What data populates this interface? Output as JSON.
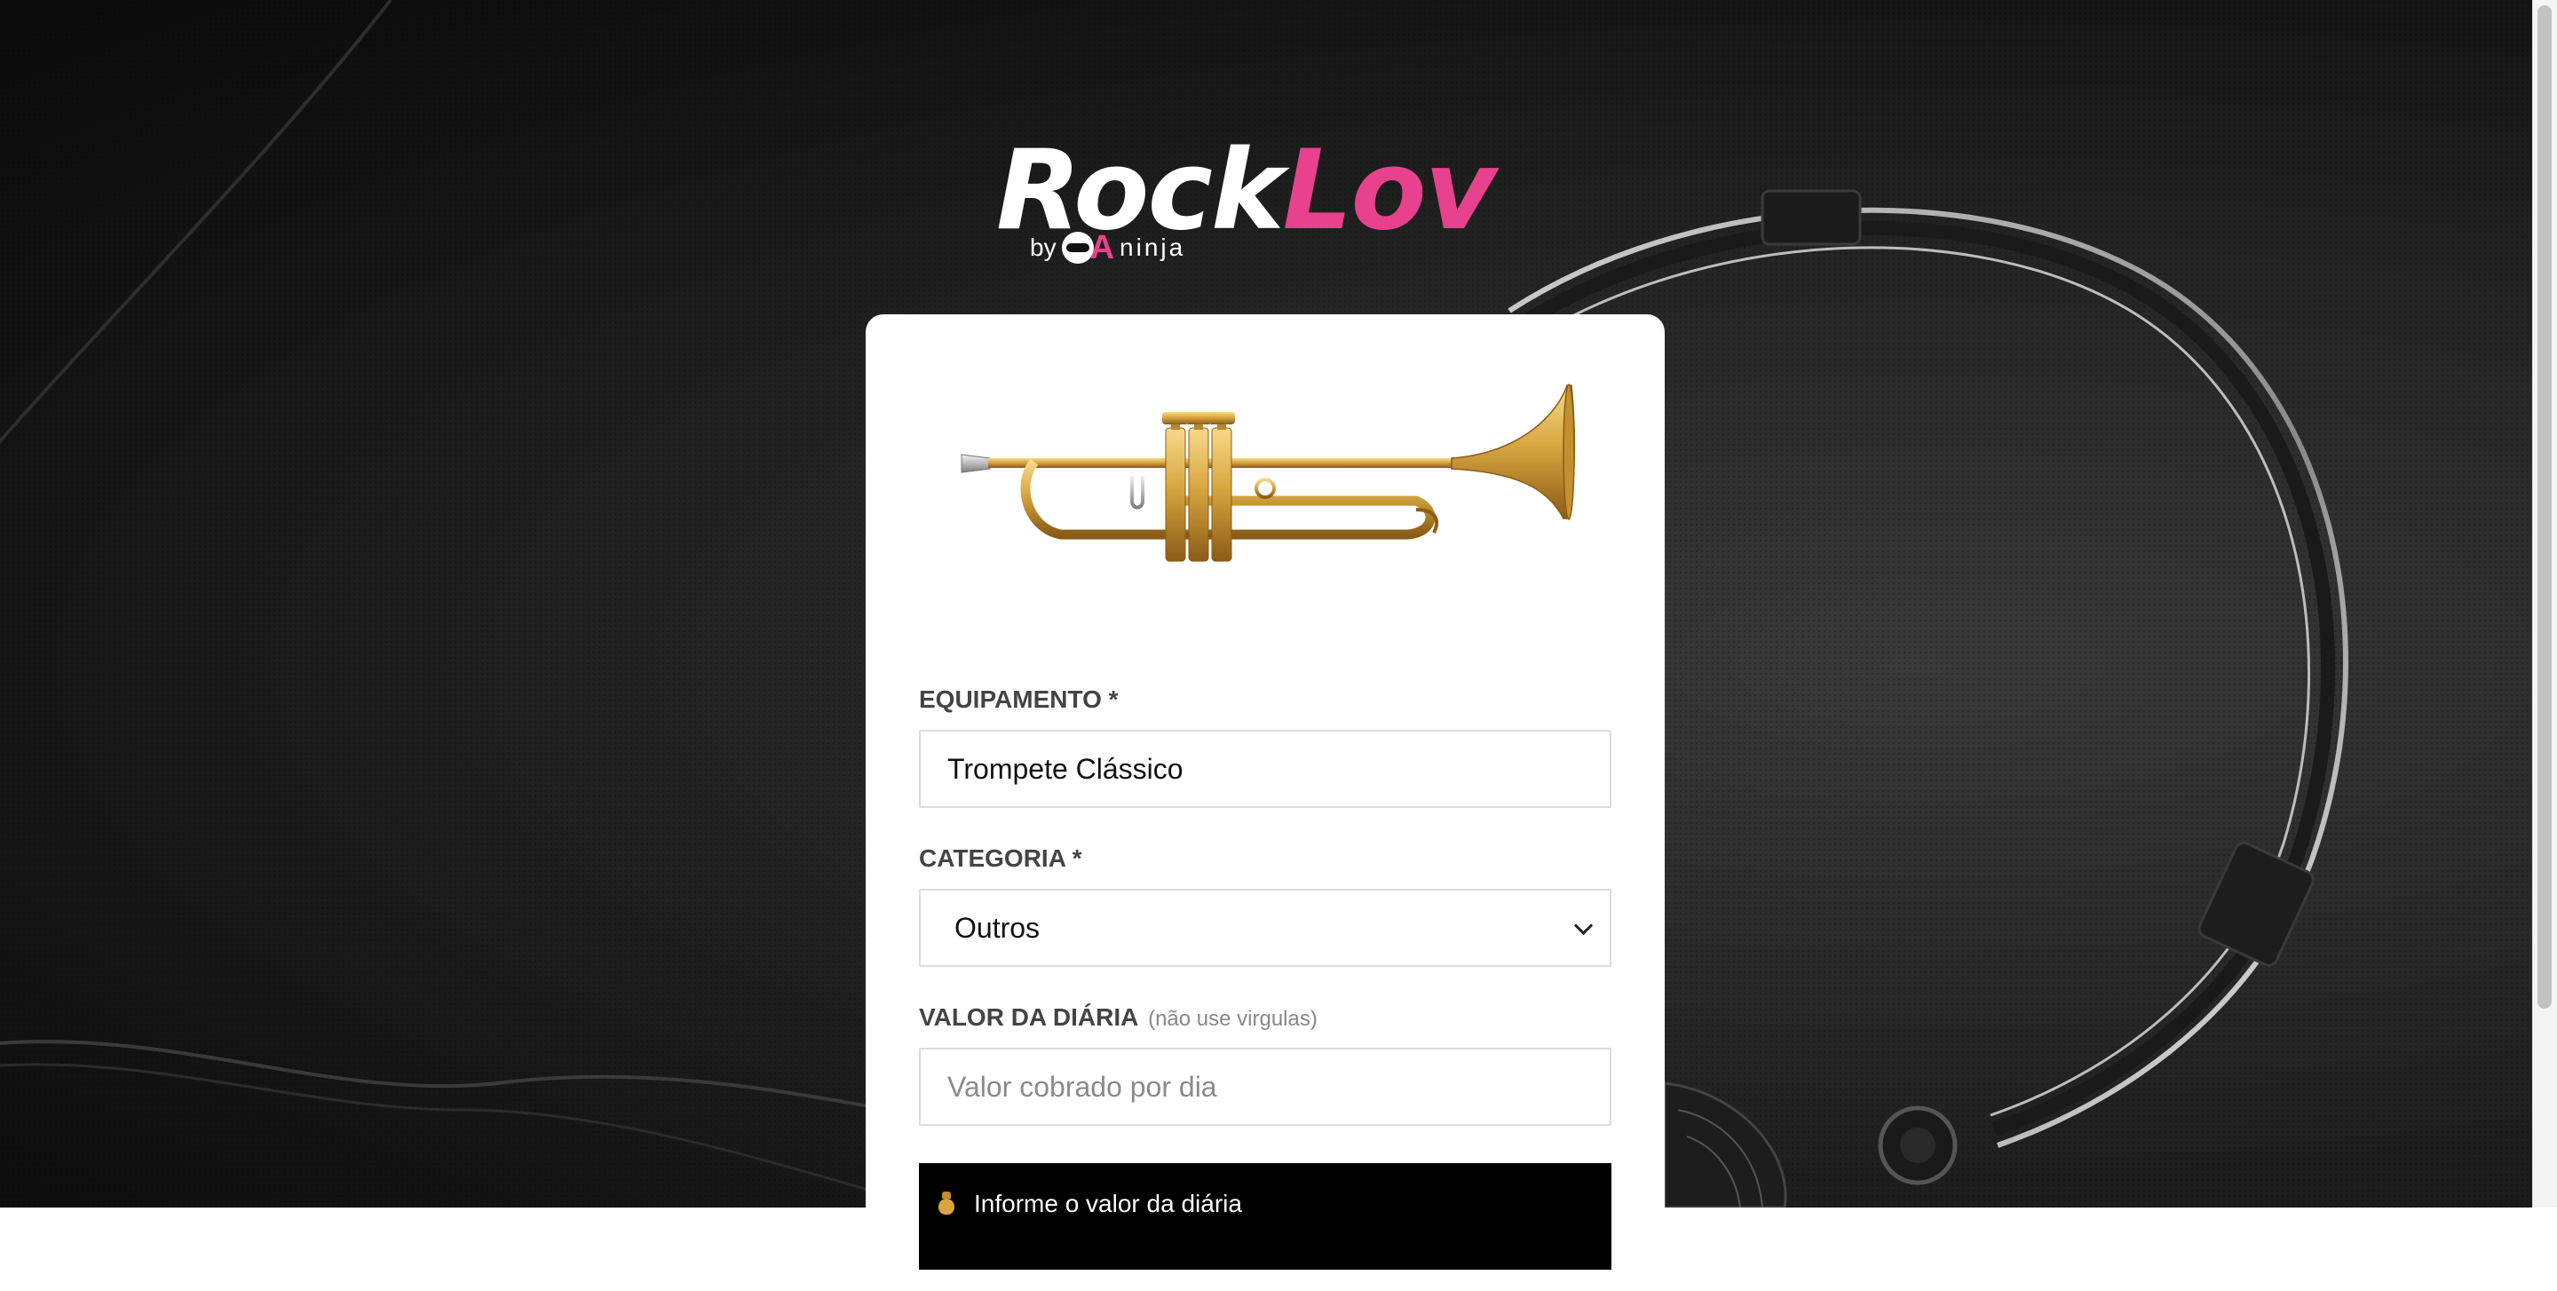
{
  "brand": {
    "name_part1": "Rock",
    "name_part2": "Lov",
    "by": "by",
    "sub_brand": "ninja",
    "brand_accent": "#e8418d"
  },
  "form": {
    "product_image_icon": "trumpet-image",
    "equipment": {
      "label": "EQUIPAMENTO *",
      "value": "Trompete Clássico"
    },
    "category": {
      "label": "CATEGORIA *",
      "selected": "Outros"
    },
    "daily_price": {
      "label": "VALOR DA DIÁRIA",
      "hint": "(não use virgulas)",
      "placeholder": "Valor cobrado por dia",
      "value": ""
    },
    "alert": {
      "icon": "money-bag-icon",
      "text": "Informe o valor da diária"
    }
  }
}
